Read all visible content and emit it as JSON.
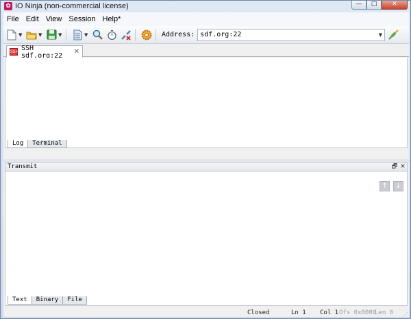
{
  "window": {
    "title": "IO Ninja (non-commercial license)",
    "app_icon_glyph": "✿",
    "min_glyph": "—",
    "max_glyph": "□",
    "close_glyph": "✕"
  },
  "menu": [
    "File",
    "Edit",
    "View",
    "Session",
    "Help*"
  ],
  "toolbar": {
    "address_label": "Address:",
    "address_value": "sdf.org:22",
    "icons": [
      "new-icon",
      "open-folder-icon",
      "save-icon",
      "document-icon",
      "search-icon",
      "stopwatch-icon",
      "disconnect-icon",
      "settings-gear-icon",
      "connect-plug-icon"
    ]
  },
  "session_tab": {
    "icon_text": "SSH",
    "label": "SSH sdf.org:22",
    "close_glyph": "✕"
  },
  "log_tabs": [
    "Log",
    "Terminal"
  ],
  "transmit": {
    "title": "Transmit",
    "float_glyph": "🗗",
    "close_glyph": "✕",
    "up_glyph": "↑",
    "down_glyph": "↓"
  },
  "transmit_tabs": [
    "Text",
    "Binary",
    "File"
  ],
  "status": {
    "connection": "Closed",
    "line": "Ln 1",
    "col": "Col 1",
    "offset": "Ofs 0x0000",
    "length": "Len 0"
  },
  "colors": {
    "title_gradient_top": "#dfe9f5",
    "close_button": "#c8432b",
    "ssh_icon": "#e53935"
  }
}
